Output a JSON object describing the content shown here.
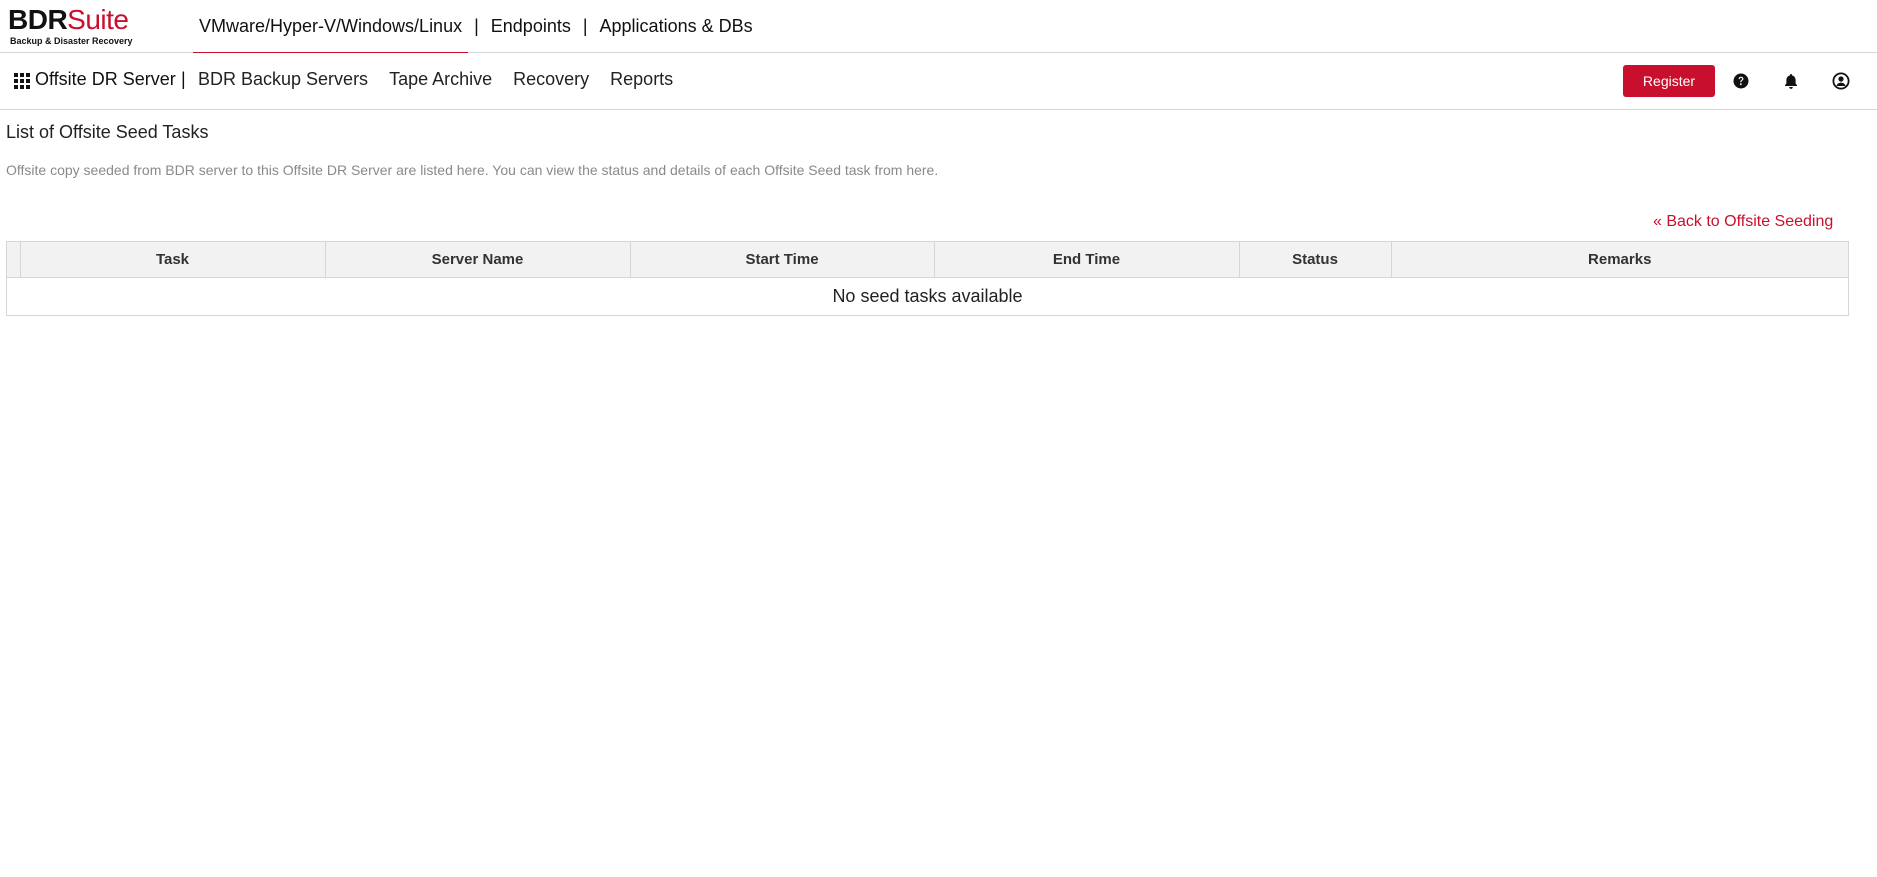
{
  "brand": {
    "logo_bold": "BDR",
    "logo_light": "Suite",
    "logo_tagline": "Backup & Disaster Recovery",
    "accent_color": "#c8102e"
  },
  "top_nav": {
    "tabs": [
      {
        "label": "VMware/Hyper-V/Windows/Linux",
        "active": true
      },
      {
        "label": "Endpoints",
        "active": false
      },
      {
        "label": "Applications & DBs",
        "active": false
      }
    ],
    "separator": "|"
  },
  "sub_nav": {
    "module_icon": "grid-icon",
    "module_title": "Offsite DR Server",
    "separator": "|",
    "items": [
      {
        "label": "BDR Backup Servers"
      },
      {
        "label": "Tape Archive"
      },
      {
        "label": "Recovery"
      },
      {
        "label": "Reports"
      }
    ],
    "register_label": "Register",
    "icons": [
      "help-icon",
      "bell-icon",
      "user-icon"
    ]
  },
  "main": {
    "title": "List of Offsite Seed Tasks",
    "description": "Offsite copy seeded from BDR server to this Offsite DR Server are listed here. You can view the status and details of each Offsite Seed task from here.",
    "back_link": "« Back to Offsite Seeding",
    "table": {
      "columns": [
        "",
        "Task",
        "Server Name",
        "Start Time",
        "End Time",
        "Status",
        "Remarks"
      ],
      "rows": [],
      "empty_message": "No seed tasks available"
    }
  }
}
